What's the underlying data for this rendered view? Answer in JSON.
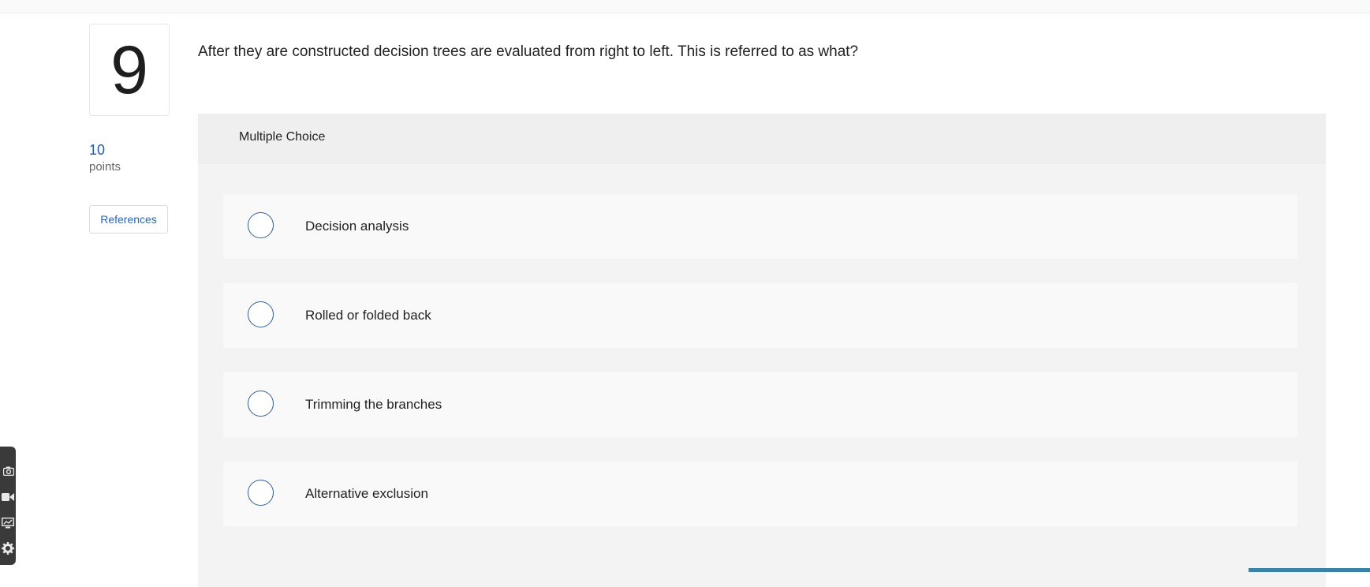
{
  "question": {
    "number": "9",
    "points_value": "10",
    "points_label": "points",
    "references_label": "References",
    "text": "After they are constructed decision trees are evaluated from right to left. This is referred to as what?"
  },
  "multiple_choice": {
    "header": "Multiple Choice",
    "options": [
      {
        "label": "Decision analysis"
      },
      {
        "label": "Rolled or folded back"
      },
      {
        "label": "Trimming the branches"
      },
      {
        "label": "Alternative exclusion"
      }
    ]
  },
  "toolbar": {
    "icons": [
      "camera-icon",
      "video-icon",
      "screen-share-icon",
      "gear-icon"
    ]
  },
  "colors": {
    "accent": "#1d5caa",
    "radio_border": "#2f5f95",
    "panel_bg": "#f3f3f3"
  }
}
